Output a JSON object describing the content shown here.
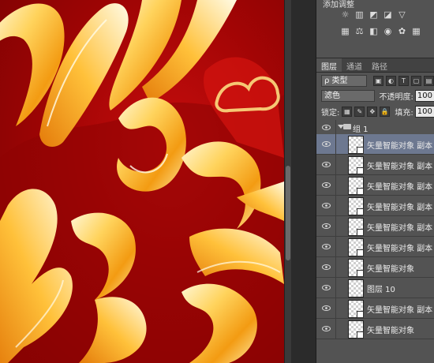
{
  "panel": {
    "adjustments_title": "添加调整",
    "adj_row1_icons": [
      "brightness-icon",
      "levels-icon",
      "curves-icon",
      "exposure-icon",
      "vibrance-icon"
    ],
    "adj_row2_icons": [
      "hue-sat-icon",
      "color-balance-icon",
      "bw-icon",
      "photo-filter-icon",
      "channel-mixer-icon",
      "color-lookup-icon"
    ],
    "tabs": [
      "图层",
      "通道",
      "路径"
    ],
    "filter_kind": "ρ 类型",
    "blend_mode": "滤色",
    "opacity_label": "不透明度:",
    "opacity_value": "100",
    "lock_label": "锁定:",
    "fill_label": "填充:",
    "fill_value": "100"
  },
  "layers": [
    {
      "name": "组 1",
      "type": "group"
    },
    {
      "name": "矢量智能对象 副本 8",
      "type": "smart",
      "selected": true
    },
    {
      "name": "矢量智能对象 副本 7",
      "type": "smart"
    },
    {
      "name": "矢量智能对象 副本 6",
      "type": "smart"
    },
    {
      "name": "矢量智能对象 副本 5",
      "type": "smart"
    },
    {
      "name": "矢量智能对象 副本 4",
      "type": "smart"
    },
    {
      "name": "矢量智能对象 副本 3",
      "type": "smart"
    },
    {
      "name": "矢量智能对象",
      "type": "smart"
    },
    {
      "name": "图层 10",
      "type": "pixel"
    },
    {
      "name": "矢量智能对象 副本",
      "type": "smart"
    },
    {
      "name": "矢量智能对象",
      "type": "smart"
    }
  ],
  "colors": {
    "canvas_red": "#b10808",
    "gold": "#f6c451",
    "panel_bg": "#535353",
    "selected_row": "#6d7890"
  }
}
